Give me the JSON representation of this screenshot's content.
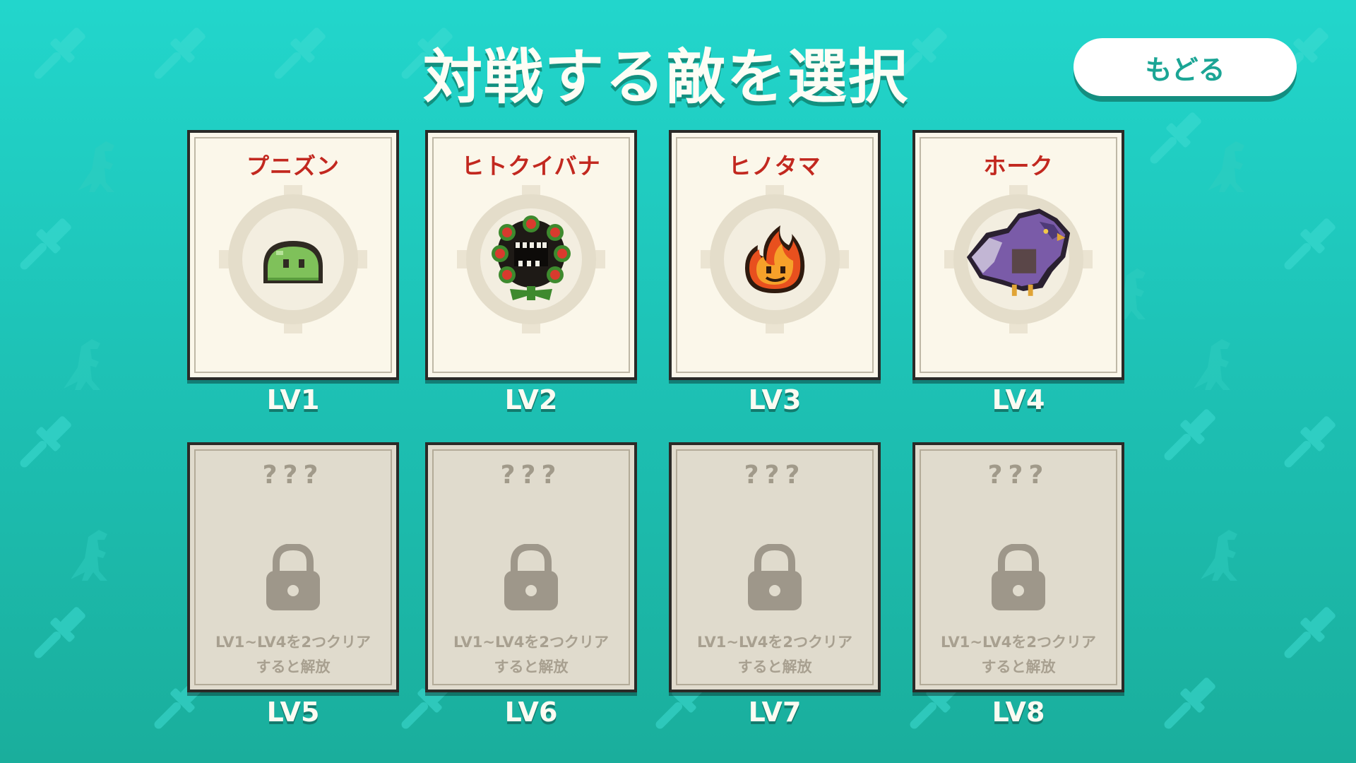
{
  "screen": {
    "title": "対戦する敵を選択",
    "back_label": "もどる"
  },
  "colors": {
    "background": "#1fcbbf",
    "enemy_name": "#c2281f",
    "card": "#fbf7ea",
    "card_locked": "#e0dbcd"
  },
  "enemies": [
    {
      "name": "プニズン",
      "level": "LV1",
      "icon": "slime-icon"
    },
    {
      "name": "ヒトクイバナ",
      "level": "LV2",
      "icon": "maneater-plant-icon"
    },
    {
      "name": "ヒノタマ",
      "level": "LV3",
      "icon": "fireball-icon"
    },
    {
      "name": "ホーク",
      "level": "LV4",
      "icon": "hawk-icon"
    }
  ],
  "locked": [
    {
      "name": "???",
      "level": "LV5",
      "condition_line1": "LV1~LV4を2つクリア",
      "condition_line2": "すると解放"
    },
    {
      "name": "???",
      "level": "LV6",
      "condition_line1": "LV1~LV4を2つクリア",
      "condition_line2": "すると解放"
    },
    {
      "name": "???",
      "level": "LV7",
      "condition_line1": "LV1~LV4を2つクリア",
      "condition_line2": "すると解放"
    },
    {
      "name": "???",
      "level": "LV8",
      "condition_line1": "LV1~LV4を2つクリア",
      "condition_line2": "すると解放"
    }
  ],
  "background_icons": [
    "paintbrush-icon",
    "dinosaur-icon"
  ]
}
